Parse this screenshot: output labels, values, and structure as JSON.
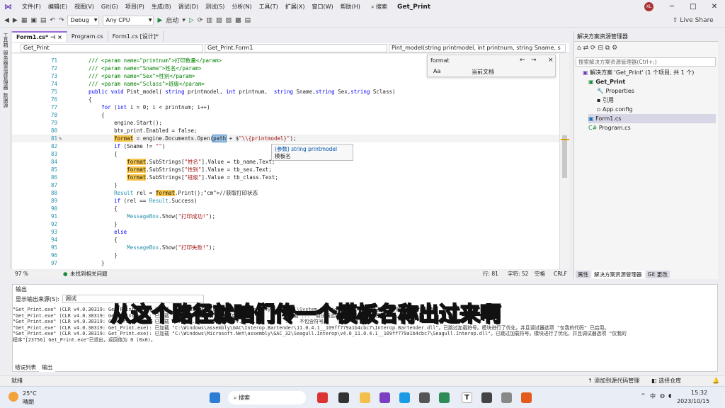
{
  "menu": {
    "items": [
      "文件(F)",
      "编辑(E)",
      "视图(V)",
      "Git(G)",
      "项目(P)",
      "生成(B)",
      "调试(D)",
      "测试(S)",
      "分析(N)",
      "工具(T)",
      "扩展(X)",
      "窗口(W)",
      "帮助(H)"
    ],
    "search_label": "搜索",
    "title": "Get_Print",
    "avatar": "XL"
  },
  "toolbar": {
    "config": "Debug",
    "platform": "Any CPU",
    "start_label": "启动",
    "live_share": "Live Share"
  },
  "leftrail": {
    "labels": [
      "工具箱",
      "服务器资源管理器",
      "数据源"
    ]
  },
  "doc_tabs": [
    "Form1.cs*",
    "Program.cs",
    "Form1.cs [设计]*"
  ],
  "navbar": {
    "project": "Get_Print",
    "class": "Get_Print.Form1",
    "member": "Pint_model(string printmodel, int printnum, string Sname, s"
  },
  "find": {
    "query": "format",
    "scope": "当前文档"
  },
  "code_lines": [
    {
      "n": "71",
      "t": "/// <param name=\"printnum\">打印数量</param>"
    },
    {
      "n": "72",
      "t": "/// <param name=\"Sname\">姓名</param>"
    },
    {
      "n": "73",
      "t": "/// <param name=\"Sex\">性别</param>"
    },
    {
      "n": "74",
      "t": "/// <param name=\"Sclass\">班级</param>"
    },
    {
      "n": "75",
      "t": "public void Pint_model( string printmodel, int printnum,  string Sname,string Sex,string Sclass)"
    },
    {
      "n": "76",
      "t": "{"
    },
    {
      "n": "77",
      "t": "    for (int i = 0; i < printnum; i++)"
    },
    {
      "n": "78",
      "t": "    {"
    },
    {
      "n": "79",
      "t": "        engine.Start();"
    },
    {
      "n": "80",
      "t": "        btn_print.Enabled = false;"
    },
    {
      "n": "81",
      "t": "        format = engine.Documents.Open(path + $\"\\\\{printmodel}\");"
    },
    {
      "n": "82",
      "t": "        if (Sname != \"\")"
    },
    {
      "n": "83",
      "t": "        {"
    },
    {
      "n": "84",
      "t": "            format.SubStrings[\"姓名\"].Value = tb_name.Text;"
    },
    {
      "n": "85",
      "t": "            format.SubStrings[\"性别\"].Value = tb_sex.Text;"
    },
    {
      "n": "86",
      "t": "            format.SubStrings[\"班级\"].Value = tb_class.Text;"
    },
    {
      "n": "87",
      "t": "        }"
    },
    {
      "n": "88",
      "t": "        Result rel = format.Print();//获取打印状态"
    },
    {
      "n": "89",
      "t": "        if (rel == Result.Success)"
    },
    {
      "n": "90",
      "t": "        {"
    },
    {
      "n": "91",
      "t": "            MessageBox.Show(\"打印成功!\");"
    },
    {
      "n": "92",
      "t": "        }"
    },
    {
      "n": "93",
      "t": "        else"
    },
    {
      "n": "94",
      "t": "        {"
    },
    {
      "n": "95",
      "t": "            MessageBox.Show(\"打印失败!\");"
    },
    {
      "n": "96",
      "t": "        }"
    },
    {
      "n": "97",
      "t": "    }"
    }
  ],
  "tooltip": {
    "line1": "(参数) string printmodel",
    "line2": "模板名"
  },
  "editor_status": {
    "zoom": "97 %",
    "issues": "未找到相关问题",
    "line": "行: 81",
    "char": "字符: 52",
    "spaces": "空格",
    "eol": "CRLF"
  },
  "solution_explorer": {
    "title": "解决方案资源管理器",
    "search_placeholder": "搜索解决方案资源管理器(Ctrl+;)",
    "items": [
      "解决方案 'Get_Print' (1 个项目, 共 1 个)",
      "Get_Print",
      "Properties",
      "引用",
      "App.config",
      "Form1.cs",
      "Program.cs"
    ],
    "tabs": [
      "属性",
      "解决方案资源管理器",
      "Git 更改"
    ]
  },
  "output": {
    "title": "输出",
    "source_label": "显示输出来源(S):",
    "source_value": "调试",
    "lines": [
      "\"Get_Print.exe\" (CLR v4.0.30319: Get_Print.exe): 已加载 \"C:\\Windows\\Microsoft.Net\\assembly\\GAC_MSIL\\System.Configurati...  模块进行了优化，并且调试器选",
      "\"Get_Print.exe\" (CLR v4.0.30319: Get_Print.exe): 已加载 ...  项 \"仅我的代码\" 已启用。       ...   已加载 ...  调试器选项 \"仅我的代码\" 已启",
      "\"Get_Print.exe\" (CLR v4.0.30319: Get_Print.exe): 已加载 ...  ....b.resources\\v4.0_...          ...  不包含符号。",
      "\"Get_Print.exe\" (CLR v4.0.30319: Get_Print.exe): 已加载 \"C:\\Windows\\assembly\\GAC\\Interop.Bartender\\11.0.4.1__109ff779a1b4cbc7\\Interop.Bartender.dll\"。已跳过加载符号。模块进行了优化，并且调试器选项 \"仅我的代码\" 已启用。",
      "\"Get_Print.exe\" (CLR v4.0.30319: Get_Print.exe): 已加载 \"C:\\Windows\\Microsoft.Net\\assembly\\GAC_32\\Seagull.Interop\\v4.0_11.0.4.1__109ff779a1b4cbc7\\Seagull.Interop.dll\"。已跳过加载符号。模块进行了优化，并且调试器选项 \"仅我的",
      "程序\"[23756] Get_Print.exe\"已退出，返回值为 0 (0x0)。"
    ],
    "tabs": [
      "错误列表",
      "输出"
    ]
  },
  "caption": "从这个路径就咱们传一个模板名称出过来啊",
  "statusbar": {
    "left": "就绪",
    "add_source": "添加到源代码管理",
    "select_repo": "选择仓库"
  },
  "taskbar": {
    "weather_temp": "25°C",
    "weather_desc": "晴朗",
    "search": "搜索",
    "time": "15:32",
    "date": "2023/10/15",
    "lang": "中"
  }
}
